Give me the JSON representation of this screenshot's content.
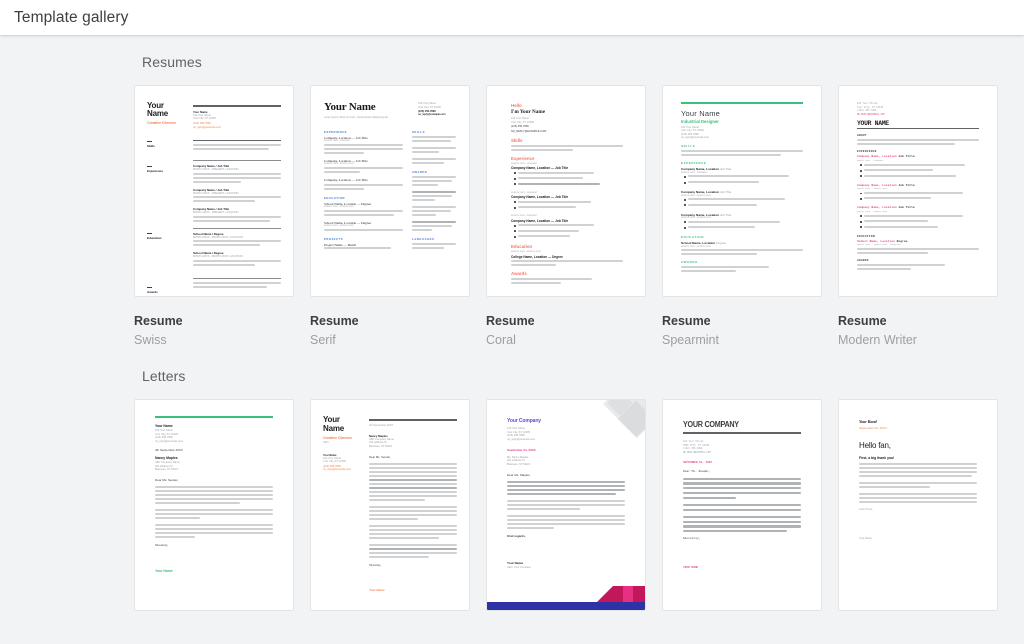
{
  "header": {
    "title": "Template gallery"
  },
  "sections": [
    {
      "id": "resumes",
      "title": "Resumes",
      "templates": [
        {
          "name": "Resume",
          "style": "Swiss"
        },
        {
          "name": "Resume",
          "style": "Serif"
        },
        {
          "name": "Resume",
          "style": "Coral"
        },
        {
          "name": "Resume",
          "style": "Spearmint"
        },
        {
          "name": "Resume",
          "style": "Modern Writer"
        }
      ]
    },
    {
      "id": "letters",
      "title": "Letters",
      "templates": [
        {
          "name": "",
          "style": ""
        },
        {
          "name": "",
          "style": ""
        },
        {
          "name": "",
          "style": ""
        },
        {
          "name": "",
          "style": ""
        },
        {
          "name": "",
          "style": ""
        }
      ]
    }
  ],
  "previews": {
    "swiss": {
      "name_line1": "Your",
      "name_line2": "Name",
      "role": "Creative Director",
      "contact_name": "Your Name",
      "contact_addr1": "123 Your Street",
      "contact_addr2": "Your City, ST 12345",
      "contact_phone": "(123) 456-7890",
      "contact_email": "no_reply@example.com",
      "labels": [
        "Skills",
        "Experience",
        "Education",
        "Awards"
      ],
      "job_title": "Company Name / Job Title",
      "job_dates": "MONTH 20XX - PRESENT, LOCATION",
      "school_title": "School Name / Degree",
      "school_dates": "MONTH 20XX - MONTH 20XX, LOCATION"
    },
    "serif": {
      "name": "Your Name",
      "tagline": "Lorem ipsum dolor sit amet, consectetuer adipiscing elit",
      "addr1": "123 Your Street",
      "addr2": "Your City, ST 12345",
      "phone": "(123) 456-7890",
      "email": "no_reply@example.com",
      "sections_main": [
        "EXPERIENCE",
        "EDUCATION",
        "PROJECTS"
      ],
      "sections_side": [
        "SKILLS",
        "AWARDS",
        "LANGUAGES"
      ],
      "job": "Company, Location — Job Title",
      "school": "School Name, Location — Degree",
      "project": "Project Name — Detail"
    },
    "coral": {
      "hello": "Hello",
      "name": "I'm Your Name",
      "addr1": "123 Your Street",
      "addr2": "Your City, ST 12345",
      "phone": "(123) 456-7890",
      "email": "NO_REPLY@EXAMPLE.COM",
      "sections": [
        "Skills",
        "Experience",
        "Education",
        "Awards"
      ],
      "job": "Company Name, Location — Job Title",
      "job_dates": "MONTH 20XX - PRESENT",
      "school": "College Name, Location — Degree"
    },
    "spearmint": {
      "name": "Your Name",
      "role": "Industrial Designer",
      "addr1": "123 Your Street",
      "addr2": "Your City, ST 12345",
      "phone": "(123) 456-7890",
      "email": "no_reply@example.com",
      "sections": [
        "SKILLS",
        "EXPERIENCE",
        "EDUCATION",
        "AWARDS"
      ],
      "job": "Company Name, Location",
      "job_title": "Job Title",
      "job_dates": "MONTH 20XX - PRESENT",
      "school": "School Name, Location",
      "degree": "Degree"
    },
    "modern_writer": {
      "addr1": "123 Your Street",
      "addr2": "Your City, ST 12345",
      "phone": "(123) 456-7890",
      "email": "NO_REPLY@EXAMPLE.COM",
      "name": "YOUR NAME",
      "sections": [
        "ABOUT",
        "EXPERIENCE",
        "EDUCATION",
        "AWARDS"
      ],
      "job": "Company Name, Location",
      "job_title": "Job Title",
      "job_dates": "MONTH 20XX - PRESENT",
      "school": "School Name, Location",
      "degree": "Degree"
    },
    "letter_spearmint": {
      "name": "Your Name",
      "addr1": "123 Your Street",
      "addr2": "Your City, ST 12345",
      "phone": "(123) 456-7890",
      "email": "no_reply@example.com",
      "date": "4th September 20XX",
      "recipient": "Nancy Maples",
      "recipient_co": "ABC Company Name",
      "recipient_addr1": "321 Address St",
      "recipient_addr2": "Business, ST 54321",
      "salutation": "Dear Ms. Sender,",
      "closing": "Sincerely,",
      "signature": "Your Name"
    },
    "letter_swiss": {
      "name_line1": "Your",
      "name_line2": "Name",
      "role": "Creative Director",
      "contact_name": "Your Name",
      "addr1": "123 Your Street",
      "addr2": "Your City, ST 12345",
      "phone": "(123) 456-7890",
      "email": "no_reply@example.com",
      "date": "4th September 20XX",
      "recipient": "Nancy Maples",
      "recipient_co": "ABC Company Name",
      "recipient_addr1": "321 Address St",
      "recipient_addr2": "Business, ST 54321",
      "salutation": "Dear Ms. Sender,",
      "closing": "Sincerely,",
      "signature": "Your Name"
    },
    "letter_geometric": {
      "company": "Your Company",
      "addr1": "123 Your Street",
      "addr2": "Your City, ST 12345",
      "phone": "(123) 456-7890",
      "email": "no_reply@example.com",
      "date": "September 04, 20XX",
      "recipient": "Ms. Nancy Maples",
      "recipient_addr1": "321 Address St",
      "recipient_addr2": "Business, ST 54321",
      "salutation": "Dear Ms. Maples,",
      "closing": "Kind regards,",
      "signature": "Your Name",
      "signature_title": "CEO, Your Company"
    },
    "letter_modern_writer": {
      "company": "YOUR COMPANY",
      "addr1": "123 Your Street",
      "addr2": "YOUR CITY, ST 12345",
      "phone": "(123) 456-7890",
      "email": "NO_REPLY@EXAMPLE.COM",
      "date": "SEPTEMBER 04, 20XX",
      "salutation": "Dear Ms. Reader,",
      "closing": "Sincerely,",
      "signature": "YOUR NAME"
    },
    "letter_band": {
      "band": "Your Band",
      "date": "September 04, 20XX",
      "greeting": "Hello fan,",
      "subheading": "First, a big thank you!",
      "closing": "Lots of love,",
      "signature": "Your Name"
    }
  },
  "colors": {
    "page_bg": "#f1f3f4",
    "card_bg": "#ffffff",
    "title_text": "#3c4043",
    "subtitle_text": "#9aa0a6",
    "accent_coral": "#f4796b",
    "accent_orange": "#f4804e",
    "accent_green": "#3bbf79",
    "accent_blue": "#3b78d8",
    "accent_pink": "#ea4b8b",
    "accent_indigo": "#2d33a6",
    "accent_purple": "#5b4ddb"
  }
}
